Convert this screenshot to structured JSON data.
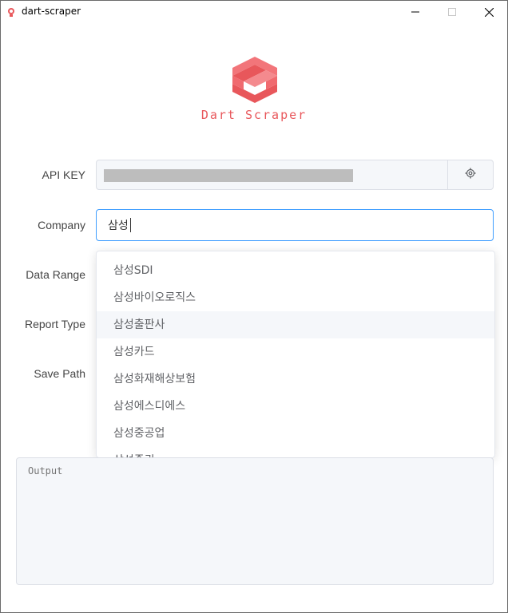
{
  "window": {
    "title": "dart-scraper",
    "buttons": {
      "minimize": "minimize-icon",
      "maximize": "maximize-icon",
      "close": "close-icon"
    }
  },
  "brand": {
    "name": "Dart Scraper",
    "logo_color": "#f05a5f"
  },
  "form": {
    "api_key": {
      "label": "API KEY",
      "settings_icon": "gear-icon"
    },
    "company": {
      "label": "Company",
      "value": "삼성"
    },
    "data_range": {
      "label": "Data Range"
    },
    "report_type": {
      "label": "Report Type"
    },
    "save_path": {
      "label": "Save Path"
    }
  },
  "suggestions": {
    "items": [
      "삼성SDI",
      "삼성바이오로직스",
      "삼성출판사",
      "삼성카드",
      "삼성화재해상보험",
      "삼성에스디에스",
      "삼성중공업",
      "삼성증권"
    ],
    "hovered_index": 2
  },
  "output": {
    "placeholder": "Output"
  },
  "colors": {
    "accent": "#409eff",
    "brand": "#e8575b",
    "field_bg": "#f5f7fa"
  }
}
